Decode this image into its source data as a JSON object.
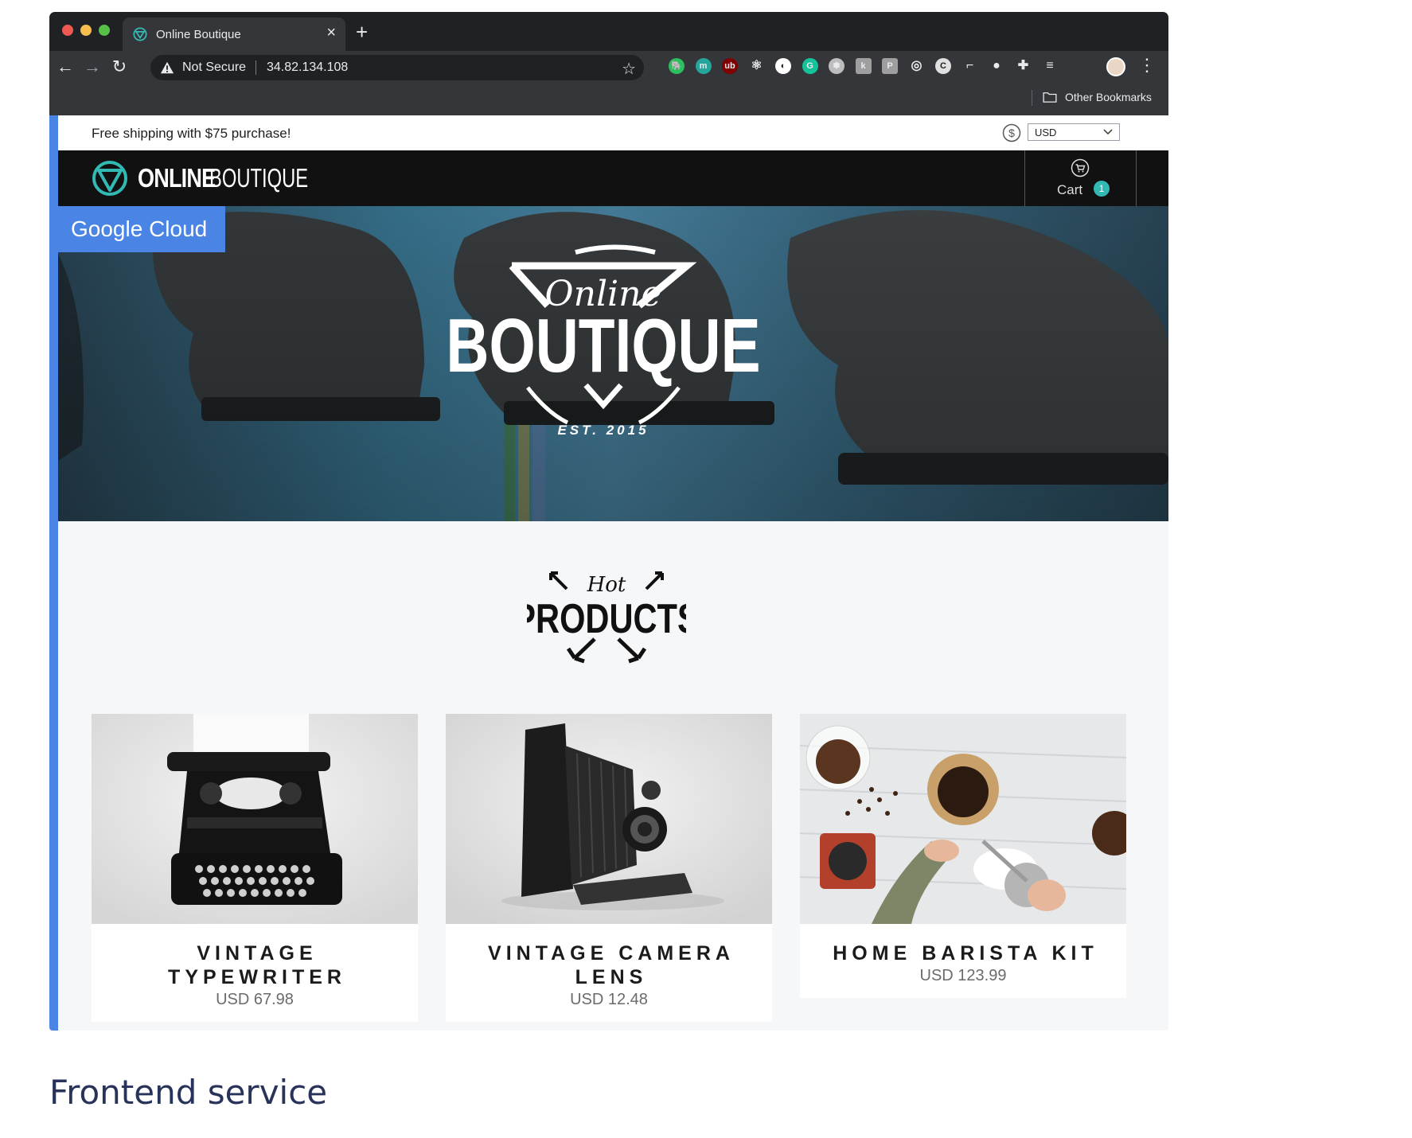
{
  "browser": {
    "tab_title": "Online Boutique",
    "tab_close": "×",
    "new_tab": "+",
    "back": "←",
    "forward": "→",
    "reload": "↻",
    "not_secure": "Not Secure",
    "url": "34.82.134.108",
    "bookmark_star": "☆",
    "menu": "⋮",
    "other_bookmarks": "Other Bookmarks"
  },
  "extensions": [
    {
      "name": "evernote-icon",
      "color": "#2dbe60",
      "glyph": "🐘"
    },
    {
      "name": "m-extension-icon",
      "color": "#26a69a",
      "glyph": "m"
    },
    {
      "name": "ublock-icon",
      "color": "#800000",
      "glyph": "ub"
    },
    {
      "name": "react-devtools-icon",
      "color": "#35363a",
      "glyph": "⚛"
    },
    {
      "name": "lighthouse-icon",
      "color": "#ffffff",
      "glyph": "◐"
    },
    {
      "name": "grammarly-icon",
      "color": "#15c39a",
      "glyph": "G"
    },
    {
      "name": "settings-extension-icon",
      "color": "#bdbdbd",
      "glyph": "✽"
    },
    {
      "name": "k-extension-icon",
      "color": "#9e9e9e",
      "glyph": "k"
    },
    {
      "name": "p-extension-icon",
      "color": "#9e9e9e",
      "glyph": "P"
    },
    {
      "name": "target-extension-icon",
      "color": "#35363a",
      "glyph": "◎"
    },
    {
      "name": "c-extension-icon",
      "color": "#e0e0e0",
      "glyph": "C"
    },
    {
      "name": "tag-extension-icon",
      "color": "#35363a",
      "glyph": "⌐"
    },
    {
      "name": "record-extension-icon",
      "color": "#35363a",
      "glyph": "●"
    },
    {
      "name": "puzzle-extensions-icon",
      "color": "#35363a",
      "glyph": "✚"
    },
    {
      "name": "reading-list-icon",
      "color": "#35363a",
      "glyph": "≡"
    }
  ],
  "site": {
    "shipping_banner": "Free shipping with $75 purchase!",
    "currency": "USD",
    "logo_online": "ONLINE",
    "logo_boutique": "BOUTIQUE",
    "cart_label": "Cart",
    "cart_count": "1",
    "google_cloud": "Google Cloud",
    "hero_online": "Online",
    "hero_boutique": "BOUTIQUE",
    "hero_est": "EST. 2015",
    "hot": "Hot",
    "products_heading": "PRODUCTS"
  },
  "products": [
    {
      "name": "VINTAGE TYPEWRITER",
      "price": "USD 67.98"
    },
    {
      "name": "VINTAGE CAMERA LENS",
      "price": "USD 12.48"
    },
    {
      "name": "HOME BARISTA KIT",
      "price": "USD 123.99"
    }
  ],
  "caption": "Frontend service",
  "colors": {
    "accent_blue": "#4a84e4",
    "brand_teal": "#33b9b4",
    "header_black": "#111111",
    "chrome_dark": "#202124"
  }
}
